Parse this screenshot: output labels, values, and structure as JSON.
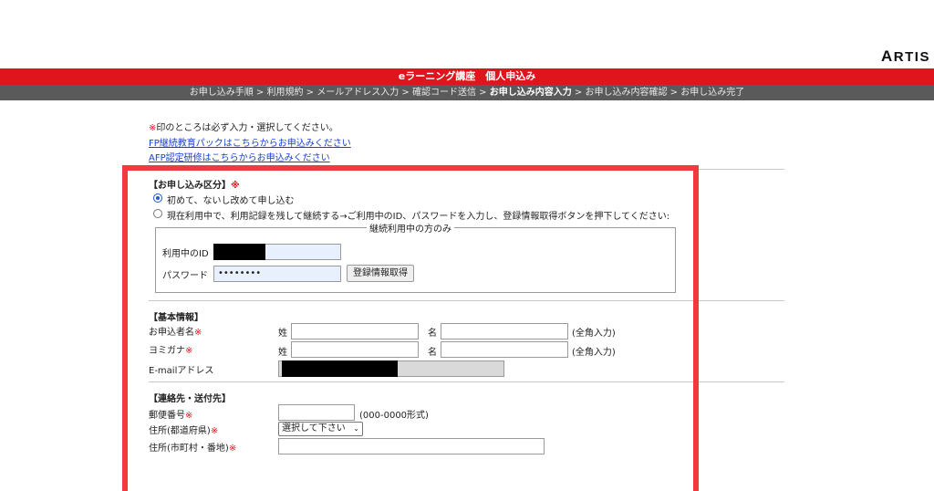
{
  "logo": {
    "first": "A",
    "rest": "RTIS"
  },
  "header": {
    "title": "eラーニング講座　個人申込み",
    "steps": [
      "お申し込み手順",
      "利用規約",
      "メールアドレス入力",
      "確認コード送信",
      "お申し込み内容入力",
      "お申し込み内容確認",
      "お申し込み完了"
    ],
    "separator": ">",
    "current_step": 4
  },
  "intro": {
    "required_mark": "※",
    "note": "印のところは必ず入力・選択してください。",
    "link1": "FP継続教育パックはこちらからお申込みください",
    "link2": "AFP認定研修はこちらからお申込みください"
  },
  "section_type": {
    "title": "【お申し込み区分】",
    "required_mark": "※",
    "option1": "初めて、ないし改めて申し込む",
    "option2": "現在利用中で、利用記録を残して継続する→ご利用中のID、パスワードを入力し、登録情報取得ボタンを押下してください:",
    "legend": "継続利用中の方のみ",
    "id_label": "利用中のID",
    "password_label": "パスワード",
    "password_value": "••••••••",
    "fetch_button": "登録情報取得"
  },
  "section_basic": {
    "title": "【基本情報】",
    "name_label": "お申込者名",
    "kana_label": "ヨミガナ",
    "email_label": "E-mailアドレス",
    "sei": "姓",
    "mei": "名",
    "fullwidth_note": "(全角入力)",
    "required_mark": "※"
  },
  "section_contact": {
    "title": "【連絡先・送付先】",
    "zip_label": "郵便番号",
    "zip_format": "(000-0000形式)",
    "pref_label": "住所(都道府県)",
    "pref_selected": "選択して下さい",
    "city_label": "住所(市町村・番地)",
    "required_mark": "※"
  },
  "colors": {
    "accent_red": "#e0141c",
    "steps_bar": "#5a5a5a",
    "highlight_box": "#f03a3f",
    "link": "#1a3fd6"
  }
}
